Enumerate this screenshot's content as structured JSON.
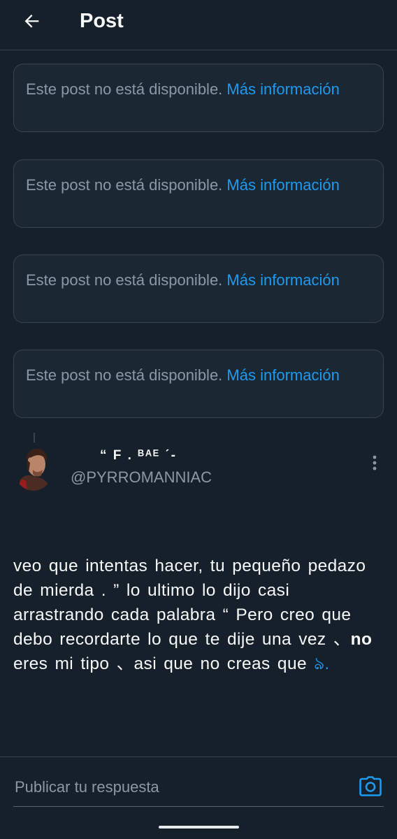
{
  "header": {
    "title": "Post",
    "back_icon": "arrow-left-icon"
  },
  "notices": [
    {
      "text": "Este post no está disponible.",
      "link": "Más información"
    },
    {
      "text": "Este post no está disponible.",
      "link": "Más información"
    },
    {
      "text": "Este post no está disponible.",
      "link": "Más información"
    },
    {
      "text": "Este post no está disponible.",
      "link": "Más información"
    }
  ],
  "post": {
    "display_name": "“ F . ᴮᴬᴱ ˊ-",
    "handle": "@PYRROMANNIAC",
    "text_part1": "veo que intentas hacer, tu pequeño pedazo de mierda . ” lo ultimo lo dijo casi arrastrando cada palabra “ Pero creo que debo recordarte lo que te dije una vez 、",
    "text_bold": "no",
    "text_part2": " eres mi tipo 、asi que no creas que ",
    "text_accent": "ঌ."
  },
  "reply": {
    "placeholder": "Publicar tu respuesta"
  },
  "colors": {
    "background": "#15202b",
    "accent": "#1d9bf0",
    "muted": "#8b98a5",
    "border": "#38444d"
  }
}
